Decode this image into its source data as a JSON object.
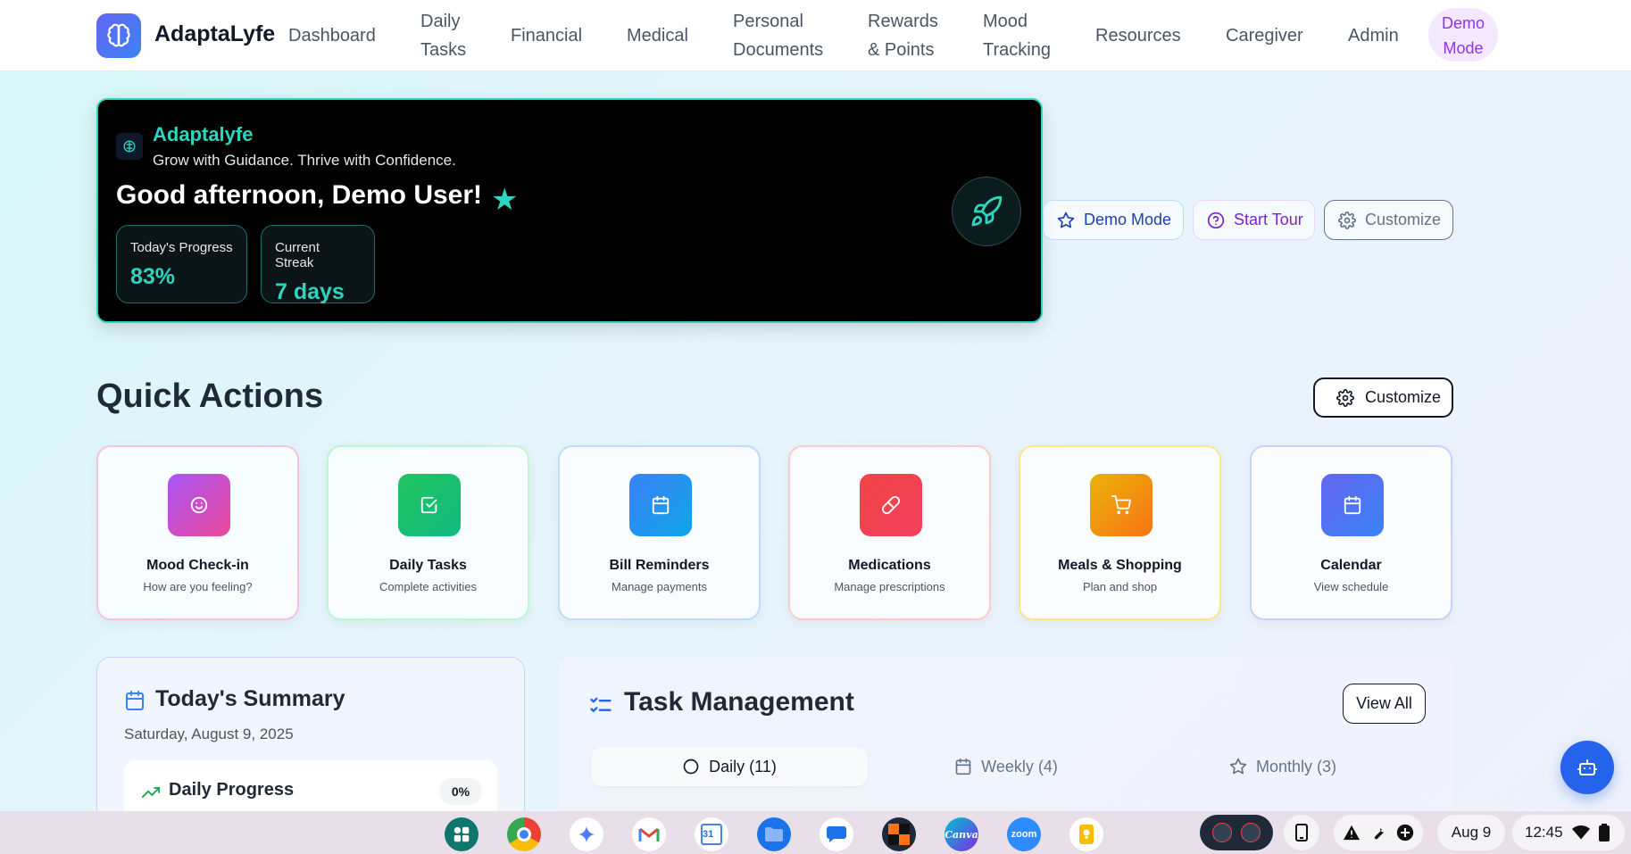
{
  "nav": {
    "brand": "AdaptaLyfe",
    "items": [
      {
        "l1": "Dashboard",
        "l2": ""
      },
      {
        "l1": "Daily",
        "l2": "Tasks"
      },
      {
        "l1": "Financial",
        "l2": ""
      },
      {
        "l1": "Medical",
        "l2": ""
      },
      {
        "l1": "Personal",
        "l2": "Documents"
      },
      {
        "l1": "Rewards",
        "l2": "& Points"
      },
      {
        "l1": "Mood",
        "l2": "Tracking"
      },
      {
        "l1": "Resources",
        "l2": ""
      },
      {
        "l1": "Caregiver",
        "l2": ""
      },
      {
        "l1": "Admin",
        "l2": ""
      }
    ],
    "demo_l1": "Demo",
    "demo_l2": "Mode"
  },
  "hero": {
    "brand": "Adaptalyfe",
    "tagline": "Grow with Guidance. Thrive with Confidence.",
    "greeting": "Good afternoon, Demo User!",
    "star": "★",
    "stats": [
      {
        "label": "Today's Progress",
        "value": "83%"
      },
      {
        "label": "Current Streak",
        "value": "7 days"
      }
    ]
  },
  "hero_actions": {
    "demo_mode": "Demo Mode",
    "start_tour": "Start Tour",
    "customize": "Customize"
  },
  "quick_actions": {
    "title": "Quick Actions",
    "customize": "Customize",
    "cards": [
      {
        "title": "Mood Check-in",
        "sub": "How are you feeling?",
        "icon": "smile-icon"
      },
      {
        "title": "Daily Tasks",
        "sub": "Complete activities",
        "icon": "check-square-icon"
      },
      {
        "title": "Bill Reminders",
        "sub": "Manage payments",
        "icon": "calendar-icon"
      },
      {
        "title": "Medications",
        "sub": "Manage prescriptions",
        "icon": "pill-icon"
      },
      {
        "title": "Meals & Shopping",
        "sub": "Plan and shop",
        "icon": "cart-icon"
      },
      {
        "title": "Calendar",
        "sub": "View schedule",
        "icon": "calendar-icon"
      }
    ]
  },
  "summary": {
    "title": "Today's Summary",
    "date": "Saturday, August 9, 2025",
    "progress_title": "Daily Progress",
    "progress_badge": "0%"
  },
  "tasks": {
    "title": "Task Management",
    "view_all": "View All",
    "tabs": [
      "Daily (11)",
      "Weekly (4)",
      "Monthly (3)"
    ]
  },
  "shelf": {
    "apps": [
      "launcher",
      "chrome",
      "gemini",
      "gmail",
      "calendar",
      "files",
      "messages",
      "app",
      "Canva",
      "zoom",
      "keep"
    ],
    "canva": "Canva",
    "zoom": "zoom",
    "cal_day": "31",
    "date": "Aug 9",
    "time": "12:45"
  },
  "colors": {
    "accent": "#2dd4bf",
    "primary": "#2563eb",
    "purple": "#9333ea"
  }
}
